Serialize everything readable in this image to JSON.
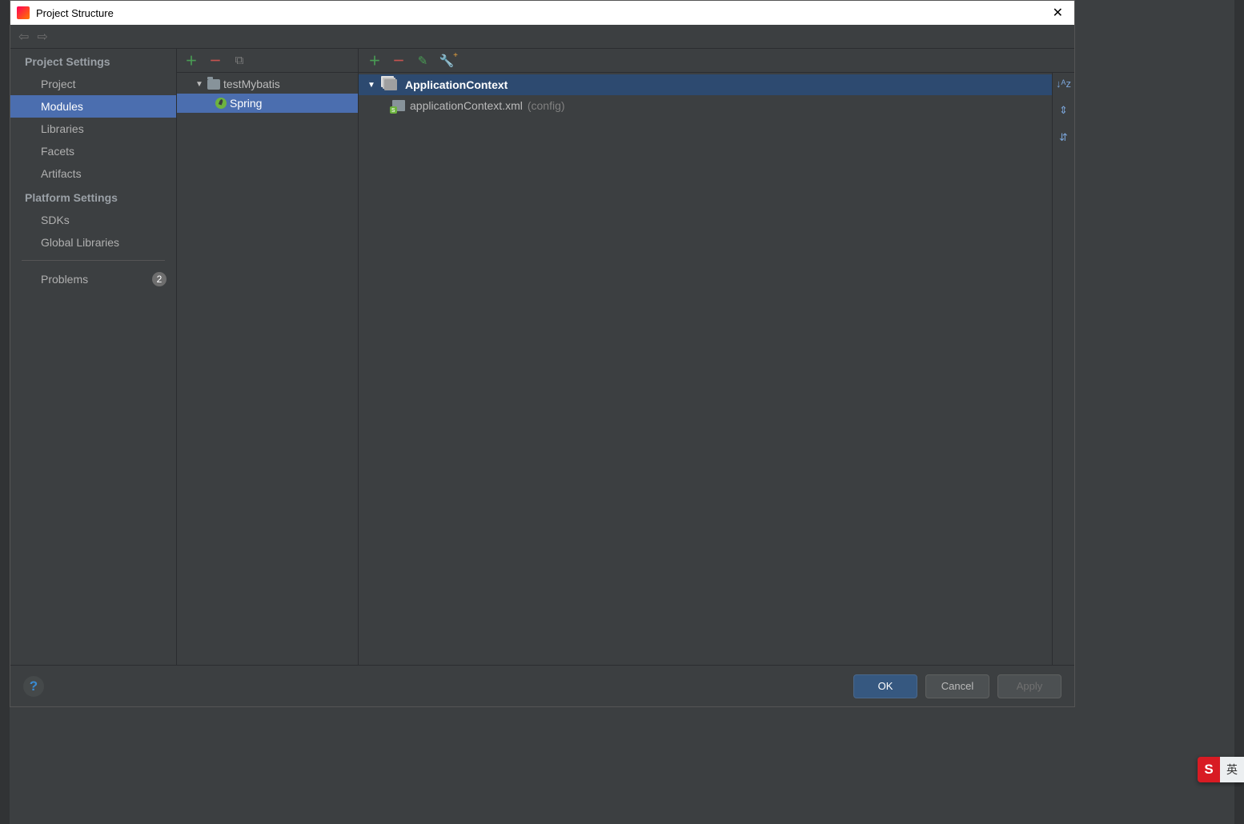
{
  "title": "Project Structure",
  "sections": {
    "project_settings_title": "Project Settings",
    "platform_settings_title": "Platform Settings",
    "items": {
      "project": "Project",
      "modules": "Modules",
      "libraries": "Libraries",
      "facets": "Facets",
      "artifacts": "Artifacts",
      "sdks": "SDKs",
      "global_libraries": "Global Libraries",
      "problems": "Problems"
    },
    "problems_count": "2"
  },
  "tree": {
    "module": "testMybatis",
    "facet": "Spring"
  },
  "content": {
    "fileset_name": "ApplicationContext",
    "file_name": "applicationContext.xml",
    "file_suffix": "(config)"
  },
  "buttons": {
    "ok": "OK",
    "cancel": "Cancel",
    "apply": "Apply"
  },
  "ime": {
    "logo": "S",
    "mode": "英"
  }
}
